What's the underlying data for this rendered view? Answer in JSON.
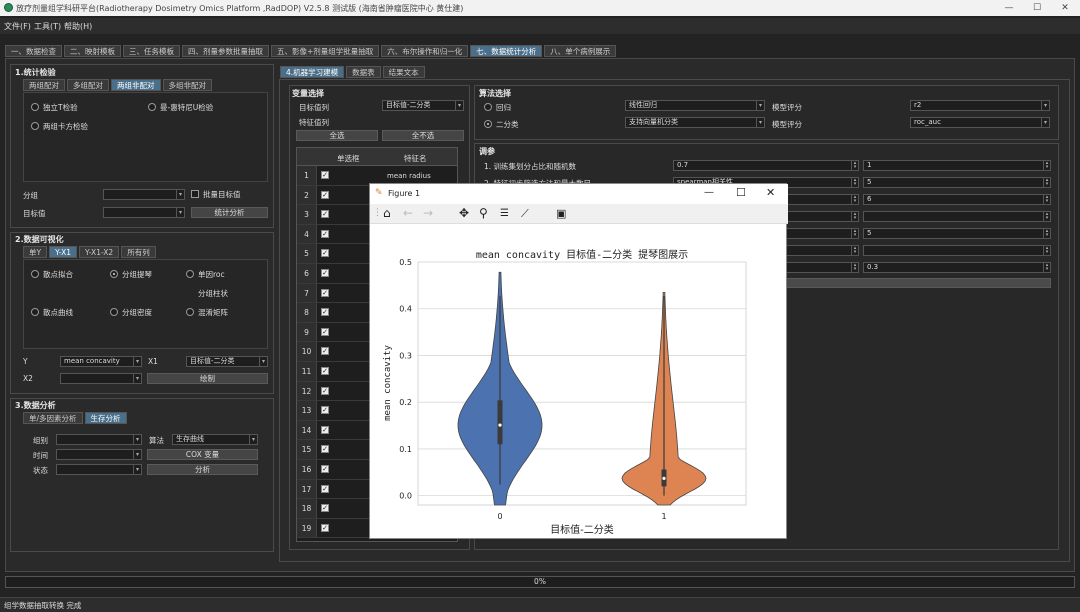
{
  "window": {
    "title": "放疗剂量组学科研平台(Radiotherapy Dosimetry Omics Platform ,RadDOP)  V2.5.8  测试版   (海南省肿瘤医院中心  黄仕建)",
    "minimize": "—",
    "maximize": "☐",
    "close": "✕"
  },
  "menu": [
    "文件(F)",
    "工具(T)",
    "帮助(H)"
  ],
  "main_tabs": [
    "一、数据检查",
    "二、映射模板",
    "三、任务模板",
    "四、剂量参数批量抽取",
    "五、影像+剂量组学批量抽取",
    "六、布尔操作和归一化",
    "七、数据统计分析",
    "八、单个病例展示"
  ],
  "stat_test": {
    "title": "1.统计检验",
    "tabs": [
      "两组配对",
      "多组配对",
      "两组非配对",
      "多组非配对"
    ],
    "options": [
      "独立T检验",
      "曼-惠特尼U检验",
      "两组卡方检验"
    ],
    "group_label": "分组",
    "target_label": "目标值",
    "batch_target": "批量目标值",
    "analyze_btn": "统计分析"
  },
  "viz": {
    "title": "2.数据可视化",
    "tabs": [
      "单Y",
      "Y-X1",
      "Y-X1-X2",
      "所有列"
    ],
    "options": [
      "散点拟合",
      "分组提琴",
      "单因roc",
      "分组柱状",
      "散点曲线",
      "分组密度",
      "混淆矩阵"
    ],
    "y_label": "Y",
    "y_value": "mean concavity",
    "x1_label": "X1",
    "x1_value": "目标值-二分类",
    "x2_label": "X2",
    "draw_btn": "绘制"
  },
  "analysis": {
    "title": "3.数据分析",
    "tabs": [
      "单/多因素分析",
      "生存分析"
    ],
    "group_label": "组别",
    "algo_label": "算法",
    "algo_value": "生存曲线",
    "time_label": "时间",
    "cox_btn": "COX 变量",
    "state_label": "状态",
    "analyze_btn": "分析"
  },
  "ml": {
    "tabs": [
      "4.机器学习建模",
      "数据表",
      "结果文本"
    ],
    "var_title": "变量选择",
    "target_col_label": "目标值列",
    "target_col_value": "目标值-二分类",
    "feature_col_label": "特征值列",
    "select_all": "全选",
    "select_none": "全不选",
    "grid_headers": [
      "单选框",
      "特征名"
    ],
    "grid_first_feature": "mean radius",
    "rows": [
      "1",
      "2",
      "3",
      "4",
      "5",
      "6",
      "7",
      "8",
      "9",
      "10",
      "11",
      "12",
      "13",
      "14",
      "15",
      "16",
      "17",
      "18",
      "19"
    ],
    "algo_title": "算法选择",
    "regression_label": "回归",
    "regression_model": "线性回归",
    "regression_score_label": "模型评分",
    "regression_score": "r2",
    "binary_label": "二分类",
    "binary_model": "支持向量机分类",
    "binary_score_label": "模型评分",
    "binary_score": "roc_auc",
    "tune_title": "调参",
    "params": [
      {
        "label": "1. 训练集划分占比和随机数",
        "v1": "0.7",
        "v2": "1"
      },
      {
        "label": "2. 特征初步筛选方法和最大数目",
        "v1": "spearman相关性",
        "v2": "5"
      },
      {
        "label": "",
        "v1": "",
        "v2": "6"
      },
      {
        "label": "",
        "v1": "",
        "v2": ""
      },
      {
        "label": "",
        "v1": "",
        "v2": "5"
      },
      {
        "label": "",
        "v1": "",
        "v2": ""
      },
      {
        "label": "",
        "v1": "",
        "v2": "0.3"
      }
    ]
  },
  "progress": "0%",
  "status": "组学数据抽取转换 完成",
  "figure": {
    "window_title": "Figure 1",
    "toolbar_icons": [
      "home-icon",
      "back-icon",
      "forward-icon",
      "pan-icon",
      "zoom-icon",
      "configure-icon",
      "edit-axis-icon",
      "save-icon"
    ]
  },
  "chart_data": {
    "type": "violin",
    "title": "mean concavity 目标值-二分类 提琴图展示",
    "xlabel": "目标值-二分类",
    "ylabel": "mean concavity",
    "categories": [
      "0",
      "1"
    ],
    "yticks": [
      "0.0",
      "0.1",
      "0.2",
      "0.3",
      "0.4",
      "0.5"
    ],
    "ylim": [
      -0.02,
      0.5
    ],
    "grid": true,
    "series": [
      {
        "category": "0",
        "color": "#4c72b0",
        "min": 0.024,
        "q1": 0.11,
        "median": 0.151,
        "q3": 0.204,
        "max": 0.427,
        "kde_max": 0.478,
        "kde_min": -0.07
      },
      {
        "category": "1",
        "color": "#dd8452",
        "min": 0.0,
        "q1": 0.02,
        "median": 0.037,
        "q3": 0.056,
        "max": 0.427,
        "kde_max": 0.435,
        "kde_min": -0.025
      }
    ]
  }
}
